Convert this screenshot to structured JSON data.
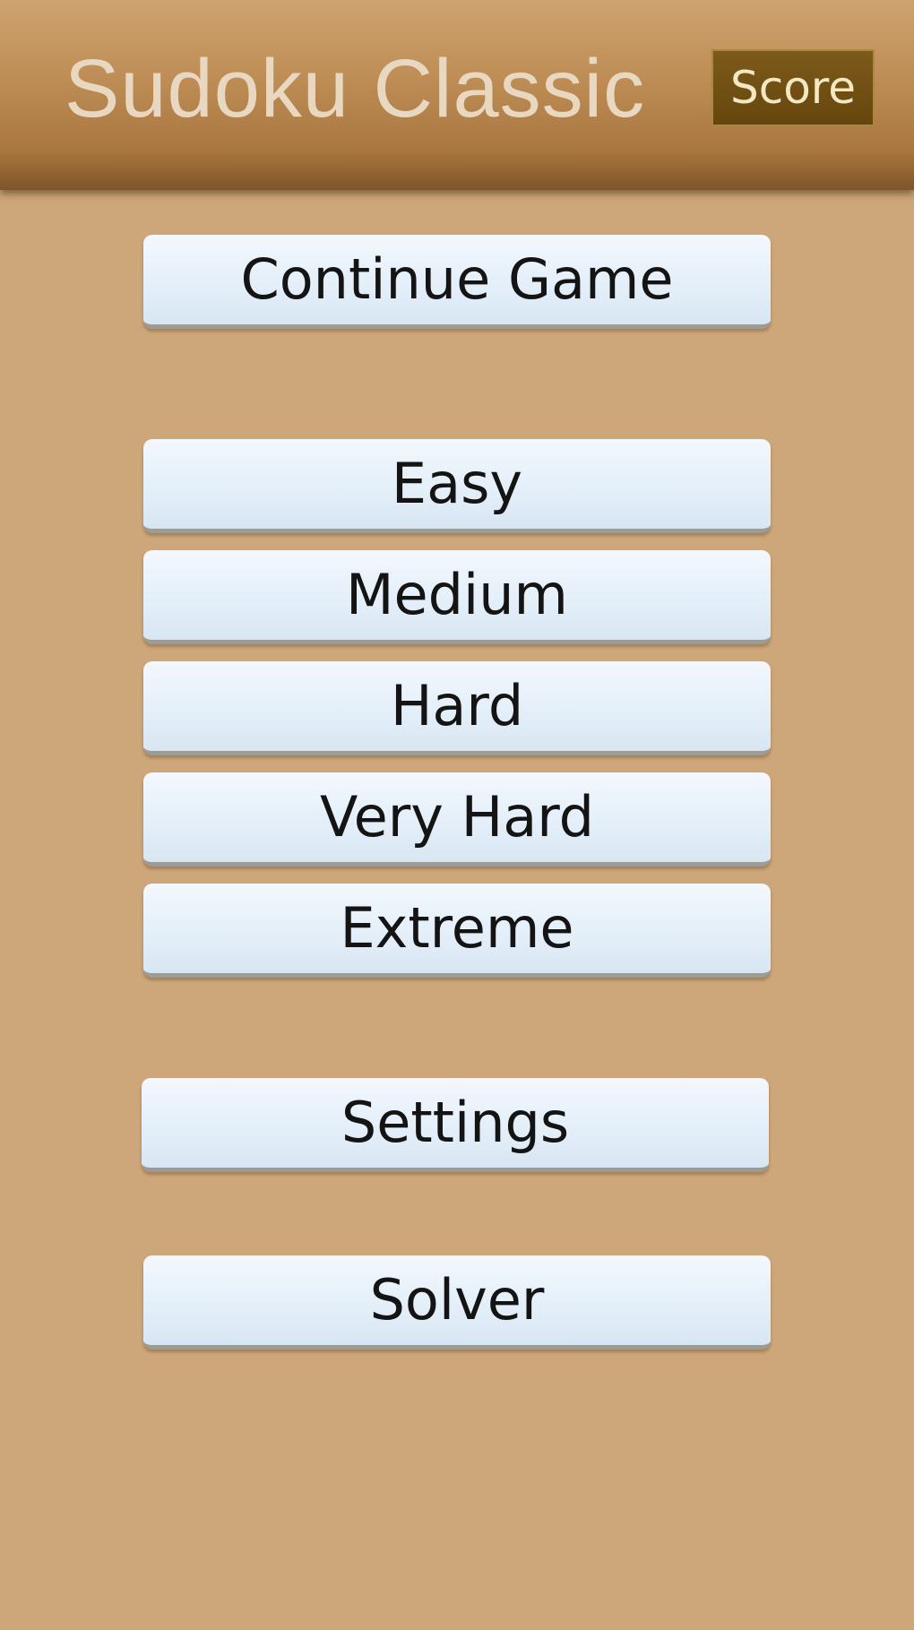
{
  "header": {
    "title": "Sudoku Classic",
    "score_label": "Score"
  },
  "menu": {
    "continue_label": "Continue Game",
    "difficulties": [
      "Easy",
      "Medium",
      "Hard",
      "Very Hard",
      "Extreme"
    ],
    "settings_label": "Settings",
    "solver_label": "Solver"
  },
  "colors": {
    "background": "#cda67a",
    "header_brown": "#a8763e",
    "score_button": "#6f4e12",
    "button_face": "#e4eff9",
    "button_text": "#141414"
  }
}
